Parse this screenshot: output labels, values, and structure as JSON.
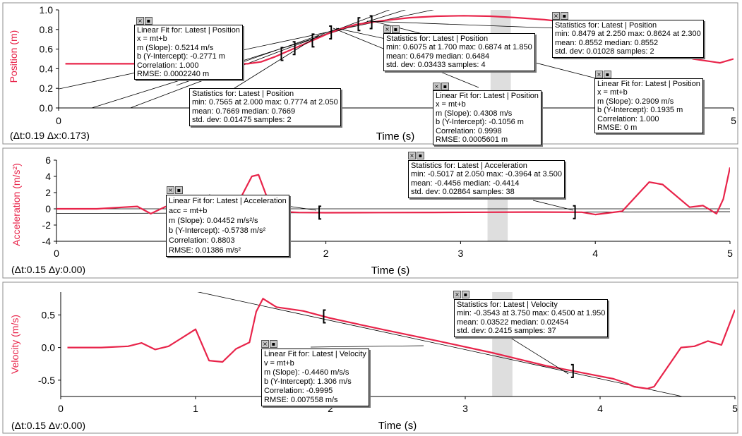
{
  "colors": {
    "series": "#e8244a",
    "shade": "#d8d8d8",
    "frame": "#8c8c8c"
  },
  "controls": {
    "close_glyph": "×",
    "menu_glyph": "▪"
  },
  "panels": [
    {
      "id": "position",
      "y_title": "Position (m)",
      "x_title": "Time (s)",
      "delta": "(Δt:0.19 Δx:0.173)"
    },
    {
      "id": "acceleration",
      "y_title": "Acceleration (m/s²)",
      "x_title": "Time (s)",
      "delta": "(Δt:0.15 Δy:0.00)"
    },
    {
      "id": "velocity",
      "y_title": "Velocity (m/s)",
      "x_title": "Time (s)",
      "delta": "(Δt:0.15 Δv:0.00)"
    }
  ],
  "chart_data": [
    {
      "type": "line",
      "xlabel": "Time (s)",
      "ylabel": "Position (m)",
      "xlim": [
        0,
        5
      ],
      "ylim": [
        0,
        1.0
      ],
      "x_ticks": [
        "0",
        "1",
        "2",
        "3",
        "4",
        "5"
      ],
      "y_ticks": [
        "0.0",
        "0.2",
        "0.4",
        "0.6",
        "0.8",
        "1.0"
      ],
      "series": [
        {
          "x": [
            0.05,
            0.5,
            1.0,
            1.4,
            1.5,
            1.6,
            1.7,
            1.8,
            1.9,
            2.0,
            2.1,
            2.2,
            2.4,
            2.6,
            2.8,
            3.0,
            3.2,
            3.4,
            3.6,
            3.8,
            4.0,
            4.2,
            4.3,
            4.5,
            4.7,
            4.9,
            5.0
          ],
          "y": [
            0.45,
            0.45,
            0.45,
            0.45,
            0.47,
            0.52,
            0.58,
            0.64,
            0.7,
            0.76,
            0.81,
            0.85,
            0.89,
            0.92,
            0.935,
            0.94,
            0.935,
            0.92,
            0.9,
            0.87,
            0.85,
            0.84,
            0.8,
            0.62,
            0.5,
            0.46,
            0.5
          ]
        }
      ],
      "fit_lines": [
        {
          "slope": 0.5214,
          "intercept": -0.2771
        },
        {
          "slope": 0.4308,
          "intercept": -0.1056
        },
        {
          "slope": 0.2909,
          "intercept": 0.1935
        }
      ],
      "brackets": [
        [
          1.65,
          1.75
        ],
        [
          1.88,
          2.02
        ],
        [
          2.22,
          2.32
        ]
      ],
      "shade": [
        3.2,
        3.35
      ]
    },
    {
      "type": "line",
      "xlabel": "Time (s)",
      "ylabel": "Acceleration (m/s²)",
      "xlim": [
        0,
        5
      ],
      "ylim": [
        -4,
        6
      ],
      "x_ticks": [
        "0",
        "1",
        "2",
        "3",
        "4",
        "5"
      ],
      "y_ticks": [
        "-4",
        "-2",
        "0",
        "2",
        "4",
        "6"
      ],
      "series": [
        {
          "x": [
            0.0,
            0.3,
            0.5,
            0.6,
            0.7,
            0.8,
            0.9,
            1.0,
            1.1,
            1.2,
            1.35,
            1.45,
            1.5,
            1.55,
            1.6,
            1.8,
            2.0,
            2.4,
            2.8,
            3.2,
            3.5,
            3.9,
            4.0,
            4.2,
            4.4,
            4.5,
            4.7,
            4.8,
            4.9,
            4.95,
            5.0
          ],
          "y": [
            0.0,
            0.0,
            0.2,
            0.3,
            -0.6,
            0.2,
            0.8,
            1.0,
            0.5,
            0.3,
            0.8,
            4.0,
            4.2,
            2.0,
            -0.3,
            -0.45,
            -0.48,
            -0.46,
            -0.44,
            -0.42,
            -0.4,
            -0.42,
            -0.7,
            -0.3,
            3.3,
            3.0,
            0.2,
            0.4,
            -0.6,
            1.2,
            5.1
          ]
        }
      ],
      "fit_lines": [
        {
          "slope": 0.04452,
          "intercept": -0.5738
        }
      ],
      "zero_line": true,
      "brackets": [
        [
          1.95,
          3.85
        ]
      ],
      "shade": [
        3.2,
        3.35
      ]
    },
    {
      "type": "line",
      "xlabel": "Time (s)",
      "ylabel": "Velocity (m/s)",
      "xlim": [
        0,
        5
      ],
      "ylim": [
        -0.75,
        0.85
      ],
      "x_ticks": [
        "0",
        "1",
        "2",
        "3",
        "4",
        "5"
      ],
      "y_ticks": [
        "0.5",
        "0.0",
        "-0.5"
      ],
      "y_tick_values": [
        0.5,
        0.0,
        -0.5
      ],
      "series": [
        {
          "x": [
            0.05,
            0.3,
            0.5,
            0.6,
            0.7,
            0.8,
            0.9,
            1.0,
            1.1,
            1.2,
            1.3,
            1.4,
            1.45,
            1.5,
            1.6,
            1.8,
            2.0,
            2.4,
            2.8,
            3.2,
            3.6,
            3.9,
            4.1,
            4.2,
            4.25,
            4.35,
            4.4,
            4.5,
            4.6,
            4.7,
            4.8,
            4.9,
            5.0
          ],
          "y": [
            0.0,
            0.0,
            0.02,
            0.07,
            -0.03,
            0.02,
            0.15,
            0.28,
            -0.2,
            -0.22,
            -0.02,
            0.08,
            0.55,
            0.75,
            0.62,
            0.56,
            0.45,
            0.27,
            0.1,
            -0.08,
            -0.28,
            -0.4,
            -0.48,
            -0.55,
            -0.6,
            -0.63,
            -0.6,
            -0.3,
            0.0,
            0.02,
            0.1,
            0.04,
            0.58
          ]
        }
      ],
      "fit_lines": [
        {
          "slope": -0.446,
          "intercept": 1.306
        }
      ],
      "brackets": [
        [
          1.95,
          3.8
        ]
      ],
      "shade": [
        3.2,
        3.35
      ]
    }
  ],
  "annotations": [
    {
      "id": "pos-fit-1",
      "lines": [
        "Linear Fit for: Latest | Position",
        "x = mt+b",
        "m (Slope): 0.5214 m/s",
        "b (Y-Intercept): -0.2771 m",
        "Correlation: 1.000",
        "RMSE: 0.0002240 m"
      ]
    },
    {
      "id": "pos-stats-1",
      "lines": [
        "Statistics for: Latest | Position",
        "min: 0.7565 at 2.000 max: 0.7774 at 2.050",
        "mean: 0.7669 median: 0.7669",
        "std. dev: 0.01475 samples: 2"
      ]
    },
    {
      "id": "pos-stats-2",
      "lines": [
        "Statistics for: Latest | Position",
        "min: 0.6075 at 1.700 max: 0.6874 at 1.850",
        "mean: 0.6479 median: 0.6484",
        "std. dev: 0.03433 samples: 4"
      ]
    },
    {
      "id": "pos-fit-2",
      "lines": [
        "Linear Fit for: Latest | Position",
        "x = mt+b",
        "m (Slope): 0.4308 m/s",
        "b (Y-Intercept): -0.1056 m",
        "Correlation: 0.9998",
        "RMSE: 0.0005601 m"
      ]
    },
    {
      "id": "pos-stats-3",
      "lines": [
        "Statistics for: Latest | Position",
        "min: 0.8479 at 2.250 max: 0.8624 at 2.300",
        "mean: 0.8552 median: 0.8552",
        "std. dev: 0.01028 samples: 2"
      ]
    },
    {
      "id": "pos-fit-3",
      "lines": [
        "Linear Fit for: Latest | Position",
        "x = mt+b",
        "m (Slope): 0.2909 m/s",
        "b (Y-Intercept): 0.1935 m",
        "Correlation: 1.000",
        "RMSE: 0 m"
      ]
    },
    {
      "id": "acc-stats",
      "lines": [
        "Statistics for: Latest | Acceleration",
        "min: -0.5017 at 2.050 max: -0.3964 at 3.500",
        "mean: -0.4456 median: -0.4414",
        "std. dev: 0.02864 samples: 38"
      ]
    },
    {
      "id": "acc-fit",
      "lines": [
        "Linear Fit for: Latest | Acceleration",
        "acc = mt+b",
        "m (Slope): 0.04452 m/s²/s",
        "b (Y-Intercept): -0.5738 m/s²",
        "Correlation: 0.8803",
        "RMSE: 0.01386 m/s²"
      ]
    },
    {
      "id": "vel-stats",
      "lines": [
        "Statistics for: Latest | Velocity",
        "min: -0.3543 at 3.750 max: 0.4500 at 1.950",
        "mean: 0.03522 median: 0.02454",
        "std. dev: 0.2415 samples: 37"
      ]
    },
    {
      "id": "vel-fit",
      "lines": [
        "Linear Fit for: Latest | Velocity",
        "v = mt+b",
        "m (Slope): -0.4460 m/s/s",
        "b (Y-Intercept): 1.306 m/s",
        "Correlation: -0.9995",
        "RMSE: 0.007558 m/s"
      ]
    }
  ]
}
